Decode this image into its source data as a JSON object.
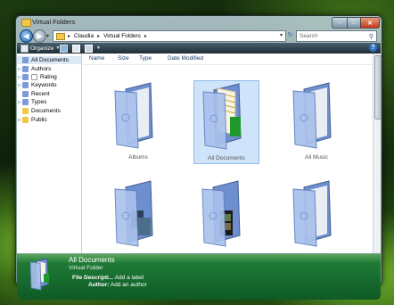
{
  "window": {
    "title": "Virtual Folders"
  },
  "address": {
    "crumbs": [
      "Claudia",
      "Virtual Folders"
    ]
  },
  "search": {
    "placeholder": "Search"
  },
  "toolbar": {
    "organize_label": "Organize"
  },
  "sidebar": {
    "items": [
      {
        "label": "All Documents",
        "expandable": false
      },
      {
        "label": "Authors",
        "expandable": true
      },
      {
        "label": "Rating",
        "expandable": true
      },
      {
        "label": "Keywords",
        "expandable": true
      },
      {
        "label": "Recent",
        "expandable": false
      },
      {
        "label": "Types",
        "expandable": true
      },
      {
        "label": "Documents",
        "expandable": false
      },
      {
        "label": "Public",
        "expandable": true
      }
    ]
  },
  "columns": [
    "Name",
    "Size",
    "Type",
    "Date Modified"
  ],
  "folders": [
    {
      "label": "Albums",
      "selected": false
    },
    {
      "label": "All Documents",
      "selected": true
    },
    {
      "label": "All Music",
      "selected": false
    },
    {
      "label": "",
      "selected": false
    },
    {
      "label": "",
      "selected": false
    },
    {
      "label": "",
      "selected": false
    }
  ],
  "details": {
    "name": "All Documents",
    "type": "Virtual Folder",
    "file_description_label": "File Descripti...",
    "file_description_value": "Add a label",
    "author_label": "Author:",
    "author_value": "Add an author"
  },
  "colors": {
    "accent": "#2f74c7",
    "details_pane": "#0e5a25",
    "folder": "#7d9bd6"
  }
}
